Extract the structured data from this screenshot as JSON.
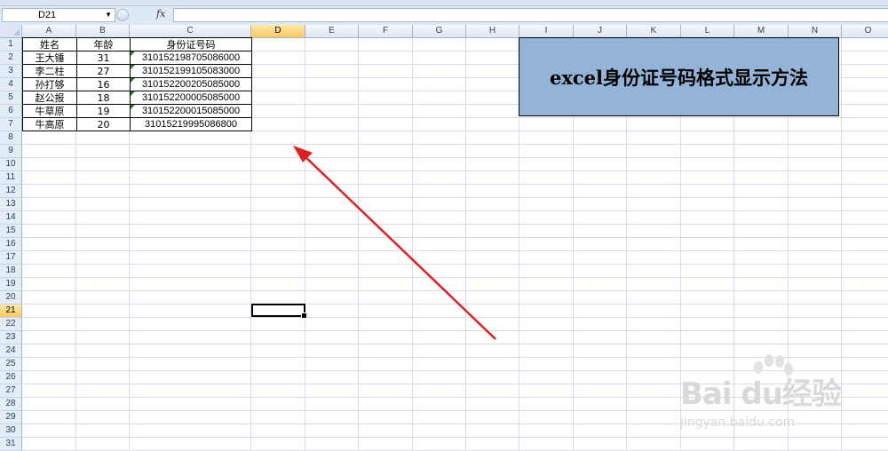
{
  "formula_bar": {
    "name_box": "D21",
    "fx_label": "fx",
    "formula": ""
  },
  "columns": [
    "A",
    "B",
    "C",
    "D",
    "E",
    "F",
    "G",
    "H",
    "I",
    "J",
    "K",
    "L",
    "M",
    "N",
    "O"
  ],
  "selected_column": "D",
  "rows": [
    "1",
    "2",
    "3",
    "4",
    "5",
    "6",
    "7",
    "8",
    "9",
    "10",
    "11",
    "12",
    "13",
    "14",
    "15",
    "16",
    "17",
    "18",
    "19",
    "20",
    "21",
    "22",
    "23",
    "24",
    "25",
    "26",
    "27",
    "28",
    "29",
    "30",
    "31"
  ],
  "selected_row": "21",
  "table": {
    "headers": [
      "姓名",
      "年龄",
      "身份证号码"
    ],
    "rows": [
      [
        "王大锤",
        "31",
        "310152198705086000"
      ],
      [
        "李二柱",
        "27",
        "310152199105083000"
      ],
      [
        "孙打够",
        "16",
        "310152200205085000"
      ],
      [
        "赵公报",
        "18",
        "310152200005085000"
      ],
      [
        "牛草原",
        "19",
        "310152200015085000"
      ],
      [
        "牛高原",
        "20",
        "31015219995086800"
      ]
    ]
  },
  "banner": {
    "text": "excel身份证号码格式显示方法"
  },
  "annotation": {
    "arrow_color": "#e02020"
  },
  "watermark": {
    "brand": "Bai du经验",
    "url": "jingyan.baidu.com"
  },
  "colors": {
    "header_bg": "#dde6f2",
    "selected_header": "#f8c960",
    "banner_bg": "#95b3d7",
    "text_indicator": "#227a22"
  }
}
